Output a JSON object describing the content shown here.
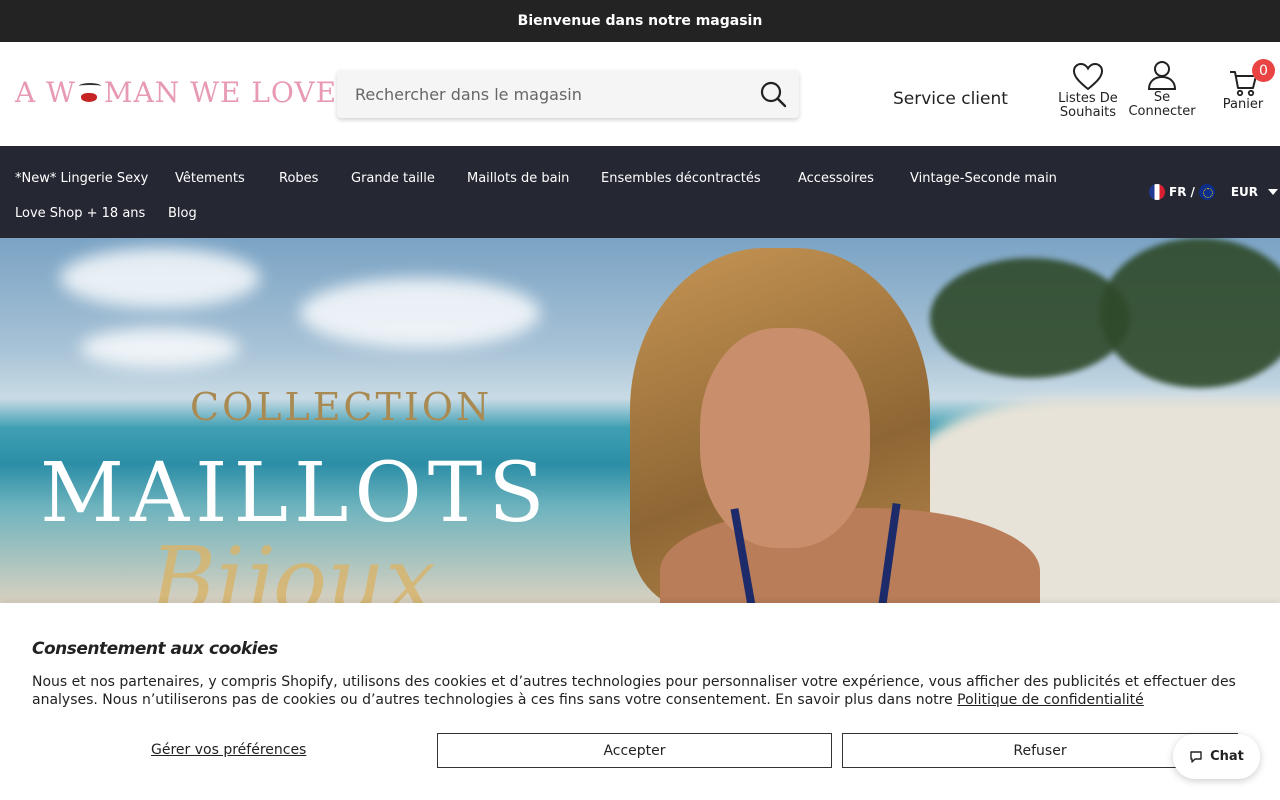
{
  "topbar": {
    "text": "Bienvenue dans notre magasin"
  },
  "header": {
    "logo_text_a": "A W",
    "logo_text_b": "MAN WE LOVE",
    "search_placeholder": "Rechercher dans le magasin",
    "service_label": "Service client",
    "wishlist_line1": "Listes De",
    "wishlist_line2": "Souhaits",
    "login_line1": "Se",
    "login_line2": "Connecter",
    "cart_label": "Panier",
    "cart_count": "0"
  },
  "nav": {
    "items": [
      "*New* Lingerie Sexy",
      "Vêtements",
      "Robes",
      "Grande taille",
      "Maillots de bain",
      "Ensembles décontractés",
      "Accessoires",
      "Vintage-Seconde main",
      "Love Shop + 18 ans",
      "Blog"
    ],
    "language": "FR",
    "currency": "EUR"
  },
  "hero": {
    "line1": "COLLECTION",
    "line2": "MAILLOTS",
    "line3": "Bijoux"
  },
  "cookie": {
    "title": "Consentement aux cookies",
    "text": "Nous et nos partenaires, y compris Shopify, utilisons des cookies et d’autres technologies pour personnaliser votre expérience, vous afficher des publicités et effectuer des analyses. Nous n’utiliserons pas de cookies ou d’autres technologies à ces fins sans votre consentement. En savoir plus dans notre ",
    "link": "Politique de confidentialité",
    "manage": "Gérer vos préférences",
    "accept": "Accepter",
    "refuse": "Refuser"
  },
  "chat": {
    "label": "Chat"
  },
  "colors": {
    "topbar": "#232323",
    "nav": "#252833",
    "badge": "#e94343",
    "logo": "#e79ab2"
  }
}
